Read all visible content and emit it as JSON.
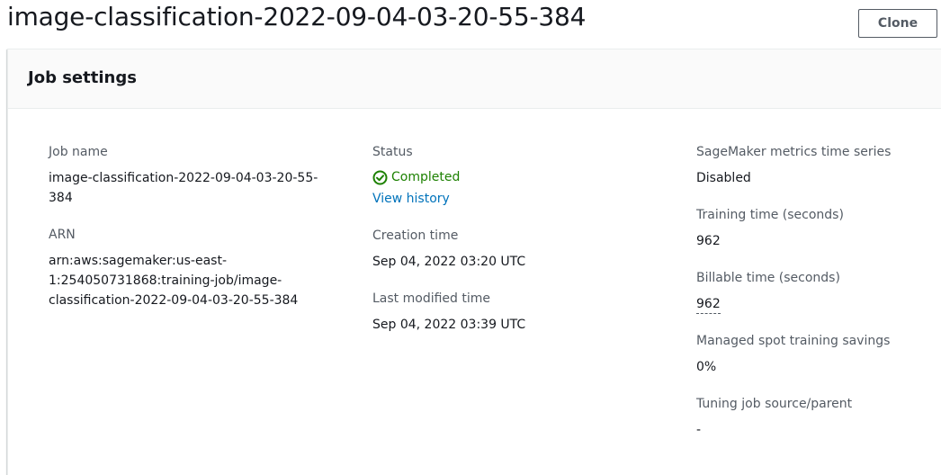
{
  "page": {
    "title": "image-classification-2022-09-04-03-20-55-384",
    "clone_label": "Clone"
  },
  "panel": {
    "title": "Job settings"
  },
  "fields": {
    "job_name": {
      "label": "Job name",
      "value": "image-classification-2022-09-04-03-20-55-384"
    },
    "arn": {
      "label": "ARN",
      "value": "arn:aws:sagemaker:us-east-1:254050731868:training-job/image-classification-2022-09-04-03-20-55-384"
    },
    "status": {
      "label": "Status",
      "value": "Completed",
      "icon": "check-circle-icon",
      "color": "#1d8102",
      "history_link": "View history"
    },
    "creation_time": {
      "label": "Creation time",
      "value": "Sep 04, 2022 03:20 UTC"
    },
    "last_modified_time": {
      "label": "Last modified time",
      "value": "Sep 04, 2022 03:39 UTC"
    },
    "metrics_time_series": {
      "label": "SageMaker metrics time series",
      "value": "Disabled"
    },
    "training_time": {
      "label": "Training time (seconds)",
      "value": "962"
    },
    "billable_time": {
      "label": "Billable time (seconds)",
      "value": "962"
    },
    "spot_savings": {
      "label": "Managed spot training savings",
      "value": "0%"
    },
    "tuning_job_source": {
      "label": "Tuning job source/parent",
      "value": "-"
    }
  },
  "colors": {
    "link": "#0073bb",
    "success": "#1d8102",
    "label": "#545b64",
    "text": "#16191f"
  }
}
